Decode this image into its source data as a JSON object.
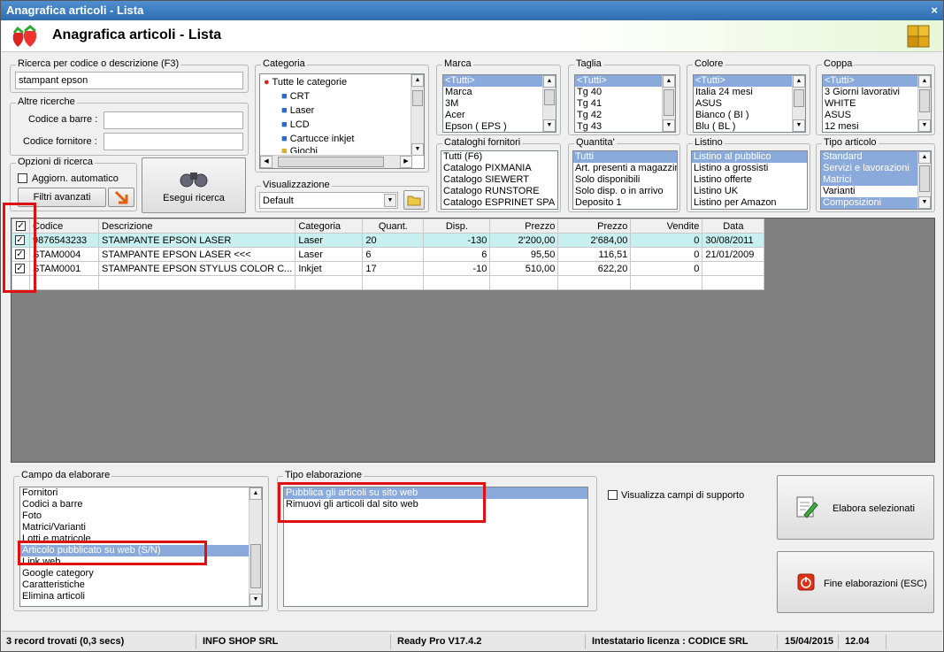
{
  "window": {
    "title": "Anagrafica articoli  - Lista",
    "close": "×"
  },
  "header": {
    "title": "Anagrafica articoli  - Lista"
  },
  "search": {
    "label": "Ricerca per codice o descrizione (F3)",
    "value": "stampant epson"
  },
  "other": {
    "label": "Altre ricerche",
    "barcode_label": "Codice a barre :",
    "supplier_label": "Codice fornitore :"
  },
  "options": {
    "label": "Opzioni di ricerca",
    "auto_label": "Aggiorn. automatico",
    "advanced_label": "Filtri avanzati",
    "search_button": "Esegui ricerca"
  },
  "categoria": {
    "label": "Categoria",
    "root": "Tutte le categorie",
    "items": [
      "CRT",
      "Laser",
      "LCD",
      "Cartucce inkjet",
      "Giochi"
    ]
  },
  "visualizzazione": {
    "label": "Visualizzazione",
    "value": "Default"
  },
  "marca": {
    "label": "Marca",
    "items": [
      "<Tutti>",
      "Marca",
      "3M",
      "Acer",
      "Epson ( EPS )"
    ]
  },
  "taglia": {
    "label": "Taglia",
    "items": [
      "<Tutti>",
      "Tg 40",
      "Tg 41",
      "Tg 42",
      "Tg 43"
    ]
  },
  "colore": {
    "label": "Colore",
    "items": [
      "<Tutti>",
      "Italia 24 mesi",
      "ASUS",
      "Bianco ( BI )",
      "Blu ( BL )"
    ]
  },
  "coppa": {
    "label": "Coppa",
    "items": [
      "<Tutti>",
      "3 Giorni lavorativi",
      "WHITE",
      "ASUS",
      "12 mesi"
    ]
  },
  "cataloghi": {
    "label": "Cataloghi fornitori",
    "items": [
      "Tutti (F6)",
      "Catalogo PIXMANIA",
      "Catalogo SIEWERT",
      "Catalogo RUNSTORE",
      "Catalogo ESPRINET SPA"
    ]
  },
  "quantita": {
    "label": "Quantita'",
    "items": [
      "Tutti",
      "Art. presenti a magazzino",
      "Solo disponibili",
      "Solo disp. o in arrivo",
      "Deposito 1"
    ]
  },
  "listino": {
    "label": "Listino",
    "items": [
      "Listino al pubblico",
      "Listino a grossisti",
      "Listino offerte",
      "Listino UK",
      "Listino per Amazon"
    ]
  },
  "tipo_articolo": {
    "label": "Tipo articolo",
    "items": [
      "Standard",
      "Servizi e lavorazioni",
      "Matrici",
      "Varianti",
      "Composizioni"
    ]
  },
  "grid": {
    "headers": [
      "Codice",
      "Descrizione",
      "Categoria",
      "Quant.",
      "Disp.",
      "Prezzo",
      "Prezzo",
      "Vendite",
      "Data"
    ],
    "rows": [
      [
        "9876543233",
        "STAMPANTE EPSON LASER",
        "Laser",
        "20",
        "-130",
        "2'200,00",
        "2'684,00",
        "0",
        "30/08/2011"
      ],
      [
        "STAM0004",
        "STAMPANTE EPSON LASER <<<",
        "Laser",
        "6",
        "6",
        "95,50",
        "116,51",
        "0",
        "21/01/2009"
      ],
      [
        "STAM0001",
        "STAMPANTE EPSON STYLUS COLOR C...",
        "Inkjet",
        "17",
        "-10",
        "510,00",
        "622,20",
        "0",
        ""
      ]
    ]
  },
  "campo": {
    "label": "Campo da elaborare",
    "items": [
      "Fornitori",
      "Codici a barre",
      "Foto",
      "Matrici/Varianti",
      "Lotti e matricole",
      "Articolo pubblicato su web (S/N)",
      "Link web",
      "Google category",
      "Caratteristiche",
      "Elimina articoli"
    ]
  },
  "tipo_elab": {
    "label": "Tipo elaborazione",
    "items": [
      "Pubblica gli articoli su sito web",
      "Rimuovi gli articoli dal sito web"
    ]
  },
  "support": {
    "label": "Visualizza campi di supporto"
  },
  "actions": {
    "process": "Elabora selezionati",
    "end": "Fine elaborazioni (ESC)"
  },
  "status": {
    "records": "3 record trovati (0,3 secs)",
    "company": "INFO SHOP SRL",
    "version": "Ready Pro V17.4.2",
    "license": "Intestatario licenza : CODICE SRL",
    "date": "15/04/2015",
    "time": "12.04"
  },
  "colors": {
    "selection": "#8aaadb",
    "highlight": "#c8f0f0",
    "annotation": "#e01010",
    "grid_bg": "#808080"
  }
}
